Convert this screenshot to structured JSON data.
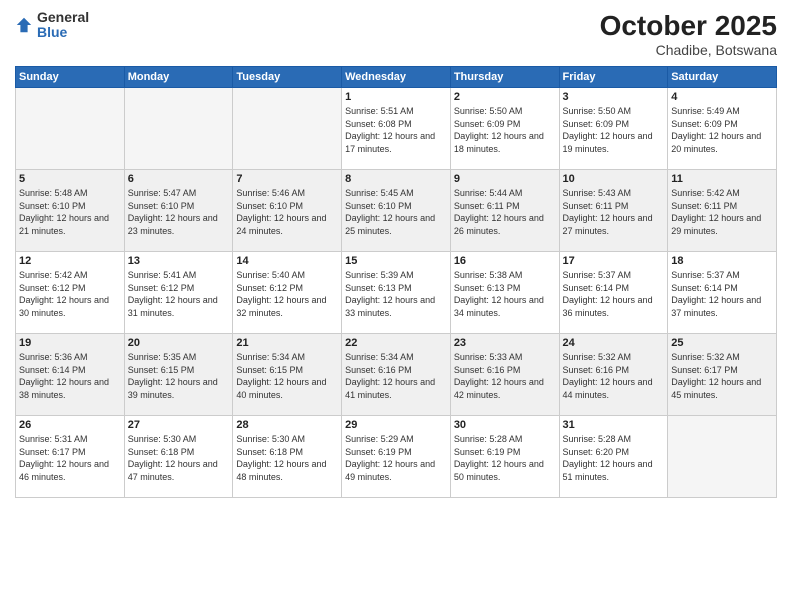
{
  "logo": {
    "general": "General",
    "blue": "Blue"
  },
  "title": "October 2025",
  "subtitle": "Chadibe, Botswana",
  "weekdays": [
    "Sunday",
    "Monday",
    "Tuesday",
    "Wednesday",
    "Thursday",
    "Friday",
    "Saturday"
  ],
  "weeks": [
    [
      {
        "day": "",
        "empty": true
      },
      {
        "day": "",
        "empty": true
      },
      {
        "day": "",
        "empty": true
      },
      {
        "day": "1",
        "sunrise": "Sunrise: 5:51 AM",
        "sunset": "Sunset: 6:08 PM",
        "daylight": "Daylight: 12 hours and 17 minutes."
      },
      {
        "day": "2",
        "sunrise": "Sunrise: 5:50 AM",
        "sunset": "Sunset: 6:09 PM",
        "daylight": "Daylight: 12 hours and 18 minutes."
      },
      {
        "day": "3",
        "sunrise": "Sunrise: 5:50 AM",
        "sunset": "Sunset: 6:09 PM",
        "daylight": "Daylight: 12 hours and 19 minutes."
      },
      {
        "day": "4",
        "sunrise": "Sunrise: 5:49 AM",
        "sunset": "Sunset: 6:09 PM",
        "daylight": "Daylight: 12 hours and 20 minutes."
      }
    ],
    [
      {
        "day": "5",
        "sunrise": "Sunrise: 5:48 AM",
        "sunset": "Sunset: 6:10 PM",
        "daylight": "Daylight: 12 hours and 21 minutes."
      },
      {
        "day": "6",
        "sunrise": "Sunrise: 5:47 AM",
        "sunset": "Sunset: 6:10 PM",
        "daylight": "Daylight: 12 hours and 23 minutes."
      },
      {
        "day": "7",
        "sunrise": "Sunrise: 5:46 AM",
        "sunset": "Sunset: 6:10 PM",
        "daylight": "Daylight: 12 hours and 24 minutes."
      },
      {
        "day": "8",
        "sunrise": "Sunrise: 5:45 AM",
        "sunset": "Sunset: 6:10 PM",
        "daylight": "Daylight: 12 hours and 25 minutes."
      },
      {
        "day": "9",
        "sunrise": "Sunrise: 5:44 AM",
        "sunset": "Sunset: 6:11 PM",
        "daylight": "Daylight: 12 hours and 26 minutes."
      },
      {
        "day": "10",
        "sunrise": "Sunrise: 5:43 AM",
        "sunset": "Sunset: 6:11 PM",
        "daylight": "Daylight: 12 hours and 27 minutes."
      },
      {
        "day": "11",
        "sunrise": "Sunrise: 5:42 AM",
        "sunset": "Sunset: 6:11 PM",
        "daylight": "Daylight: 12 hours and 29 minutes."
      }
    ],
    [
      {
        "day": "12",
        "sunrise": "Sunrise: 5:42 AM",
        "sunset": "Sunset: 6:12 PM",
        "daylight": "Daylight: 12 hours and 30 minutes."
      },
      {
        "day": "13",
        "sunrise": "Sunrise: 5:41 AM",
        "sunset": "Sunset: 6:12 PM",
        "daylight": "Daylight: 12 hours and 31 minutes."
      },
      {
        "day": "14",
        "sunrise": "Sunrise: 5:40 AM",
        "sunset": "Sunset: 6:12 PM",
        "daylight": "Daylight: 12 hours and 32 minutes."
      },
      {
        "day": "15",
        "sunrise": "Sunrise: 5:39 AM",
        "sunset": "Sunset: 6:13 PM",
        "daylight": "Daylight: 12 hours and 33 minutes."
      },
      {
        "day": "16",
        "sunrise": "Sunrise: 5:38 AM",
        "sunset": "Sunset: 6:13 PM",
        "daylight": "Daylight: 12 hours and 34 minutes."
      },
      {
        "day": "17",
        "sunrise": "Sunrise: 5:37 AM",
        "sunset": "Sunset: 6:14 PM",
        "daylight": "Daylight: 12 hours and 36 minutes."
      },
      {
        "day": "18",
        "sunrise": "Sunrise: 5:37 AM",
        "sunset": "Sunset: 6:14 PM",
        "daylight": "Daylight: 12 hours and 37 minutes."
      }
    ],
    [
      {
        "day": "19",
        "sunrise": "Sunrise: 5:36 AM",
        "sunset": "Sunset: 6:14 PM",
        "daylight": "Daylight: 12 hours and 38 minutes."
      },
      {
        "day": "20",
        "sunrise": "Sunrise: 5:35 AM",
        "sunset": "Sunset: 6:15 PM",
        "daylight": "Daylight: 12 hours and 39 minutes."
      },
      {
        "day": "21",
        "sunrise": "Sunrise: 5:34 AM",
        "sunset": "Sunset: 6:15 PM",
        "daylight": "Daylight: 12 hours and 40 minutes."
      },
      {
        "day": "22",
        "sunrise": "Sunrise: 5:34 AM",
        "sunset": "Sunset: 6:16 PM",
        "daylight": "Daylight: 12 hours and 41 minutes."
      },
      {
        "day": "23",
        "sunrise": "Sunrise: 5:33 AM",
        "sunset": "Sunset: 6:16 PM",
        "daylight": "Daylight: 12 hours and 42 minutes."
      },
      {
        "day": "24",
        "sunrise": "Sunrise: 5:32 AM",
        "sunset": "Sunset: 6:16 PM",
        "daylight": "Daylight: 12 hours and 44 minutes."
      },
      {
        "day": "25",
        "sunrise": "Sunrise: 5:32 AM",
        "sunset": "Sunset: 6:17 PM",
        "daylight": "Daylight: 12 hours and 45 minutes."
      }
    ],
    [
      {
        "day": "26",
        "sunrise": "Sunrise: 5:31 AM",
        "sunset": "Sunset: 6:17 PM",
        "daylight": "Daylight: 12 hours and 46 minutes."
      },
      {
        "day": "27",
        "sunrise": "Sunrise: 5:30 AM",
        "sunset": "Sunset: 6:18 PM",
        "daylight": "Daylight: 12 hours and 47 minutes."
      },
      {
        "day": "28",
        "sunrise": "Sunrise: 5:30 AM",
        "sunset": "Sunset: 6:18 PM",
        "daylight": "Daylight: 12 hours and 48 minutes."
      },
      {
        "day": "29",
        "sunrise": "Sunrise: 5:29 AM",
        "sunset": "Sunset: 6:19 PM",
        "daylight": "Daylight: 12 hours and 49 minutes."
      },
      {
        "day": "30",
        "sunrise": "Sunrise: 5:28 AM",
        "sunset": "Sunset: 6:19 PM",
        "daylight": "Daylight: 12 hours and 50 minutes."
      },
      {
        "day": "31",
        "sunrise": "Sunrise: 5:28 AM",
        "sunset": "Sunset: 6:20 PM",
        "daylight": "Daylight: 12 hours and 51 minutes."
      },
      {
        "day": "",
        "empty": true
      }
    ]
  ]
}
